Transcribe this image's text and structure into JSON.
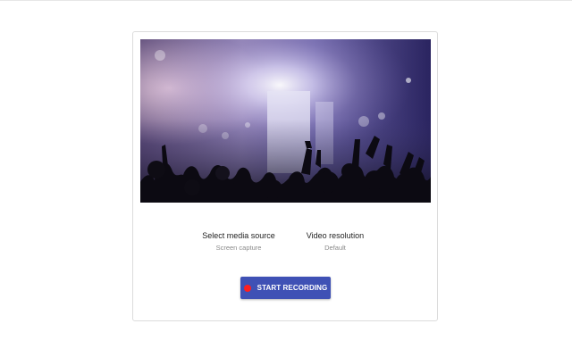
{
  "recorder": {
    "media_source_label": "Select media source",
    "media_source_value": "Screen capture",
    "resolution_label": "Video resolution",
    "resolution_value": "Default",
    "start_button_label": "START RECORDING"
  },
  "colors": {
    "accent": "#3f51b5",
    "record_dot": "#ff1f1f"
  },
  "icons": {
    "record": "record-dot-icon"
  }
}
